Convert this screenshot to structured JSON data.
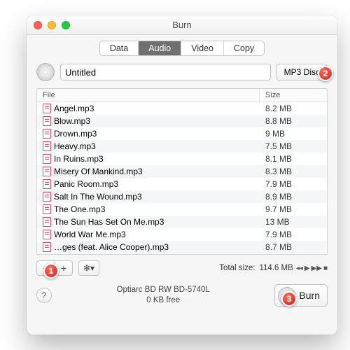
{
  "window": {
    "title": "Burn"
  },
  "tabs": {
    "items": [
      "Data",
      "Audio",
      "Video",
      "Copy"
    ],
    "active_index": 1
  },
  "project": {
    "name": "Untitled",
    "disc_type_label": "MP3 Disc"
  },
  "table": {
    "columns": {
      "file": "File",
      "size": "Size"
    },
    "rows": [
      {
        "file": "Angel.mp3",
        "size": "8.2 MB"
      },
      {
        "file": "Blow.mp3",
        "size": "8.8 MB"
      },
      {
        "file": "Drown.mp3",
        "size": "9 MB"
      },
      {
        "file": "Heavy.mp3",
        "size": "7.5 MB"
      },
      {
        "file": "In Ruins.mp3",
        "size": "8.1 MB"
      },
      {
        "file": "Misery Of Mankind.mp3",
        "size": "8.3 MB"
      },
      {
        "file": "Panic Room.mp3",
        "size": "7.9 MB"
      },
      {
        "file": "Salt In The Wound.mp3",
        "size": "8.9 MB"
      },
      {
        "file": "The One.mp3",
        "size": "9.7 MB"
      },
      {
        "file": "The Sun Has Set On Me.mp3",
        "size": "13 MB"
      },
      {
        "file": "World War Me.mp3",
        "size": "7.9 MB"
      },
      {
        "file": "…ges (feat. Alice Cooper).mp3",
        "size": "8.7 MB"
      }
    ]
  },
  "footer": {
    "total_label": "Total size:",
    "total_value": "114.6 MB",
    "remove_glyph": "−",
    "add_glyph": "+",
    "gear_glyph": "✻▾",
    "media_glyphs": [
      "◂◂",
      "▶",
      "▶▶",
      "■"
    ]
  },
  "drive": {
    "name": "Optiarc BD RW BD-5740L",
    "free": "0 KB free"
  },
  "actions": {
    "burn_label": "Burn",
    "help_glyph": "?"
  },
  "badges": {
    "b1": "1",
    "b2": "2",
    "b3": "3"
  }
}
